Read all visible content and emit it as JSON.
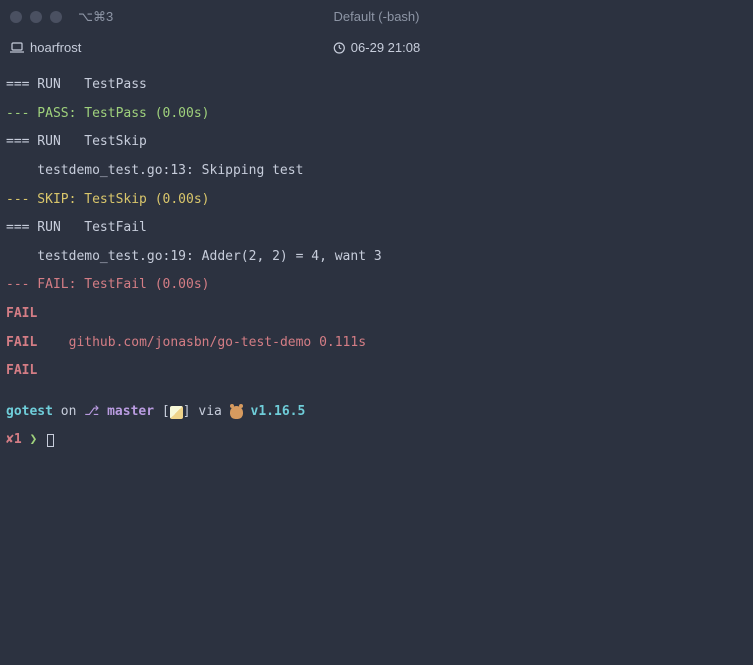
{
  "titlebar": {
    "tab_shortcut": "⌥⌘3",
    "title": "Default (-bash)"
  },
  "statusbar": {
    "host": "hoarfrost",
    "datetime": "06-29 21:08"
  },
  "output": {
    "run1": "=== RUN   TestPass",
    "pass1": "--- PASS: TestPass (0.00s)",
    "run2": "=== RUN   TestSkip",
    "skip_log": "    testdemo_test.go:13: Skipping test",
    "skip1": "--- SKIP: TestSkip (0.00s)",
    "run3": "=== RUN   TestFail",
    "fail_log": "    testdemo_test.go:19: Adder(2, 2) = 4, want 3",
    "fail1": "--- FAIL: TestFail (0.00s)",
    "fail_plain1": "FAIL",
    "fail_pkg_prefix": "FAIL    ",
    "fail_pkg": "github.com/jonasbn/go-test-demo 0.111s",
    "fail_plain2": "FAIL"
  },
  "prompt": {
    "dir": "gotest",
    "on": " on ",
    "branch_glyph": "⎇",
    "branch_space": " ",
    "branch": "master",
    "bracket_open": " [",
    "bracket_close": "]",
    "via": " via ",
    "go_version": " v1.16.5",
    "exit_code": "✘1",
    "arrow": " ❯"
  }
}
